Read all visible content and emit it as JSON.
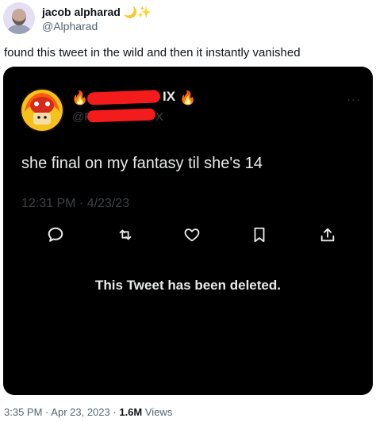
{
  "author": {
    "name": "jacob alpharad",
    "name_emoji": "🌙✨",
    "handle": "@Alpharad"
  },
  "tweet": {
    "text": "found this tweet in the wild and then it instantly vanished",
    "time": "3:35 PM",
    "separator": "·",
    "date": "Apr 23, 2023",
    "views_count": "1.6M",
    "views_label": "Views"
  },
  "screenshot": {
    "name_fragment": "IX",
    "handle_fragment_left": "@Fl",
    "handle_fragment_right": "X",
    "more_label": "···",
    "text": "she final on my fantasy til she's 14",
    "timestamp": "12:31 PM · 4/23/23",
    "deleted_notice": "This Tweet has been deleted.",
    "actions": [
      "reply-icon",
      "retweet-icon",
      "like-icon",
      "bookmark-icon",
      "share-icon"
    ],
    "redaction_color": "#f31b1b"
  }
}
